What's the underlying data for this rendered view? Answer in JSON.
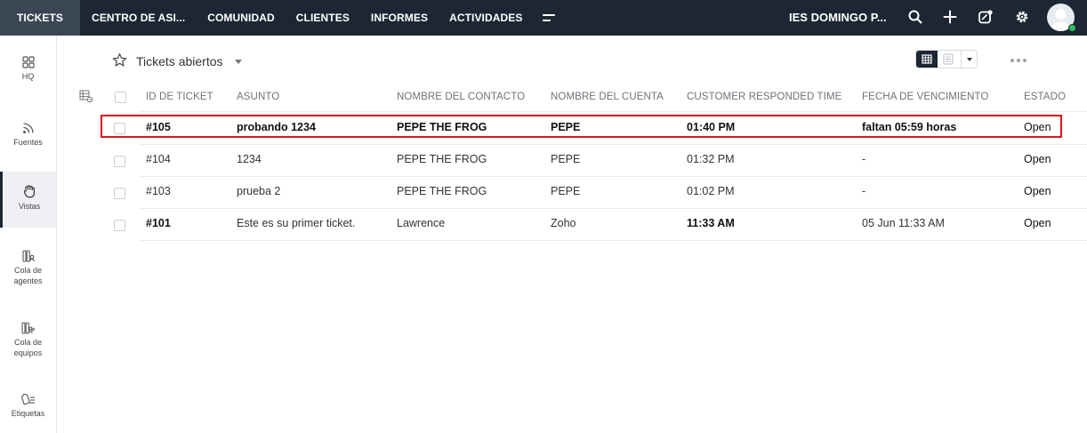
{
  "topnav": {
    "tabs": [
      "TICKETS",
      "CENTRO DE ASI...",
      "COMUNIDAD",
      "CLIENTES",
      "INFORMES",
      "ACTIVIDADES"
    ],
    "department": "IES DOMINGO P...",
    "icons": [
      "search-icon",
      "plus-icon",
      "compose-icon",
      "gear-icon",
      "avatar"
    ]
  },
  "sidebar": {
    "items": [
      {
        "label": "HQ",
        "icon": "grid-icon"
      },
      {
        "label": "Fuentes",
        "icon": "rss-icon"
      },
      {
        "label": "Vistas",
        "icon": "hand-icon"
      },
      {
        "label": "Cola de agentes",
        "icon": "agent-queue-icon"
      },
      {
        "label": "Cola de equipos",
        "icon": "team-queue-icon"
      },
      {
        "label": "Etiquetas",
        "icon": "tag-icon"
      }
    ]
  },
  "view": {
    "title": "Tickets abiertos"
  },
  "table": {
    "headers": [
      "ID DE TICKET",
      "ASUNTO",
      "NOMBRE DEL CONTACTO",
      "NOMBRE DEL CUENTA",
      "CUSTOMER RESPONDED TIME",
      "FECHA DE VENCIMIENTO",
      "ESTADO"
    ],
    "rows": [
      {
        "id": "#105",
        "asunto": "probando 1234",
        "contacto": "PEPE THE FROG",
        "cuenta": "PEPE",
        "responded": "01:40 PM",
        "vencimiento": "faltan 05:59 horas",
        "estado": "Open"
      },
      {
        "id": "#104",
        "asunto": "1234",
        "contacto": "PEPE THE FROG",
        "cuenta": "PEPE",
        "responded": "01:32 PM",
        "vencimiento": "-",
        "estado": "Open"
      },
      {
        "id": "#103",
        "asunto": "prueba 2",
        "contacto": "PEPE THE FROG",
        "cuenta": "PEPE",
        "responded": "01:02 PM",
        "vencimiento": "-",
        "estado": "Open"
      },
      {
        "id": "#101",
        "asunto": "Este es su primer ticket.",
        "contacto": "Lawrence",
        "cuenta": "Zoho",
        "responded": "11:33 AM",
        "vencimiento": "05 Jun 11:33 AM",
        "estado": "Open"
      }
    ]
  },
  "colors": {
    "topbar": "#1c2733",
    "highlight": "#d9161c",
    "online": "#2fbf5b"
  }
}
